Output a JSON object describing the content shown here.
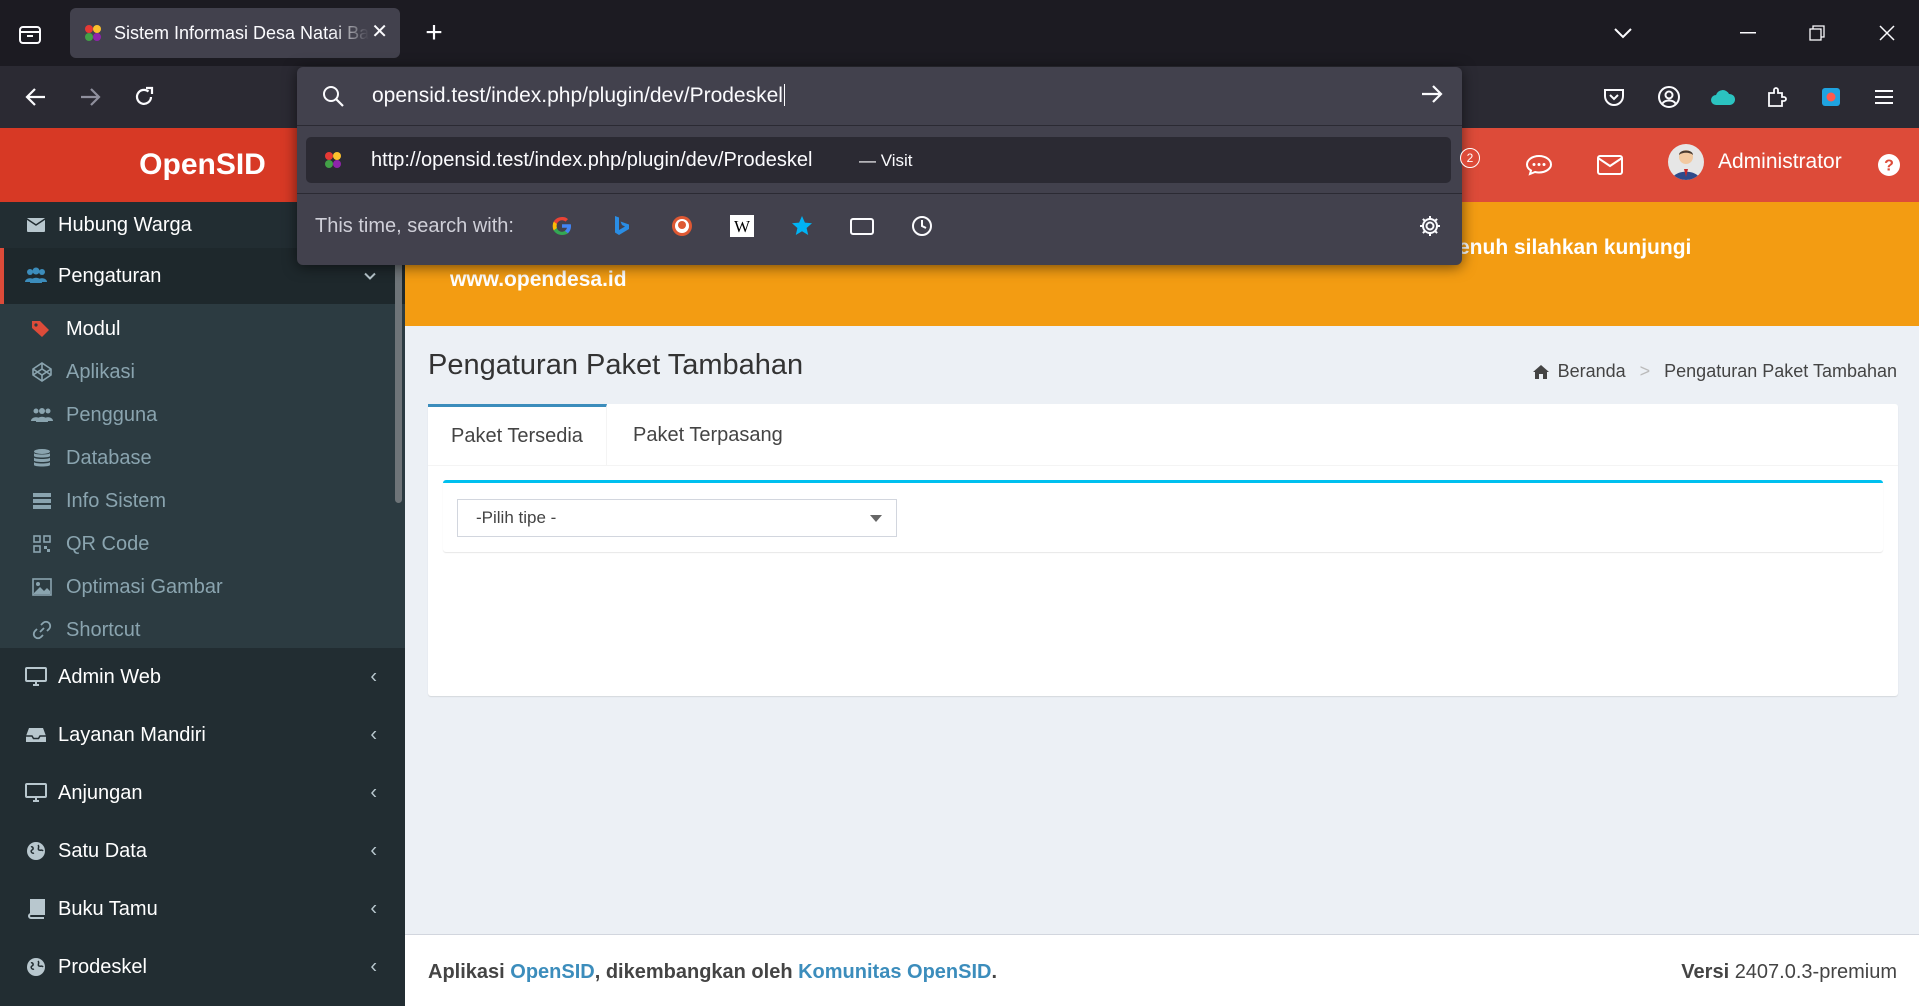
{
  "browser": {
    "tab_title": "Sistem Informasi Desa Natai Baru",
    "url_input": "opensid.test/index.php/plugin/dev/Prodeskel",
    "suggestion_url": "http://opensid.test/index.php/plugin/dev/Prodeskel",
    "suggestion_action": "— Visit",
    "search_with_label": "This time, search with:",
    "engines": [
      "google-icon",
      "bing-icon",
      "duckduckgo-icon",
      "wikipedia-icon",
      "bookmarks-icon",
      "tabs-icon",
      "history-icon"
    ]
  },
  "header": {
    "logo": "OpenSID",
    "notif_count": "2",
    "user_name": "Administrator"
  },
  "alert": {
    "line1": "enuh silahkan kunjungi",
    "line2": "www.opendesa.id"
  },
  "sidebar": {
    "top_item": "Hubung Warga",
    "active_menu": "Pengaturan",
    "submenu": [
      "Modul",
      "Aplikasi",
      "Pengguna",
      "Database",
      "Info Sistem",
      "QR Code",
      "Optimasi Gambar",
      "Shortcut"
    ],
    "menus": [
      "Admin Web",
      "Layanan Mandiri",
      "Anjungan",
      "Satu Data",
      "Buku Tamu",
      "Prodeskel"
    ]
  },
  "content": {
    "title": "Pengaturan Paket Tambahan",
    "breadcrumb_home": "Beranda",
    "breadcrumb_current": "Pengaturan Paket Tambahan",
    "tabs": [
      "Paket Tersedia",
      "Paket Terpasang"
    ],
    "select_value": "-Pilih tipe -"
  },
  "footer": {
    "prefix": "Aplikasi",
    "app_link": "OpenSID",
    "middle": ", dikembangkan oleh",
    "community_link": "Komunitas OpenSID",
    "end": ".",
    "version_label": "Versi",
    "version": "2407.0.3-premium"
  },
  "colors": {
    "header_red": "#dd4b39",
    "alert_orange": "#f39c12",
    "sidebar_dark": "#222d32",
    "link_blue": "#3c8dbc",
    "accent_cyan": "#00c0ef"
  }
}
